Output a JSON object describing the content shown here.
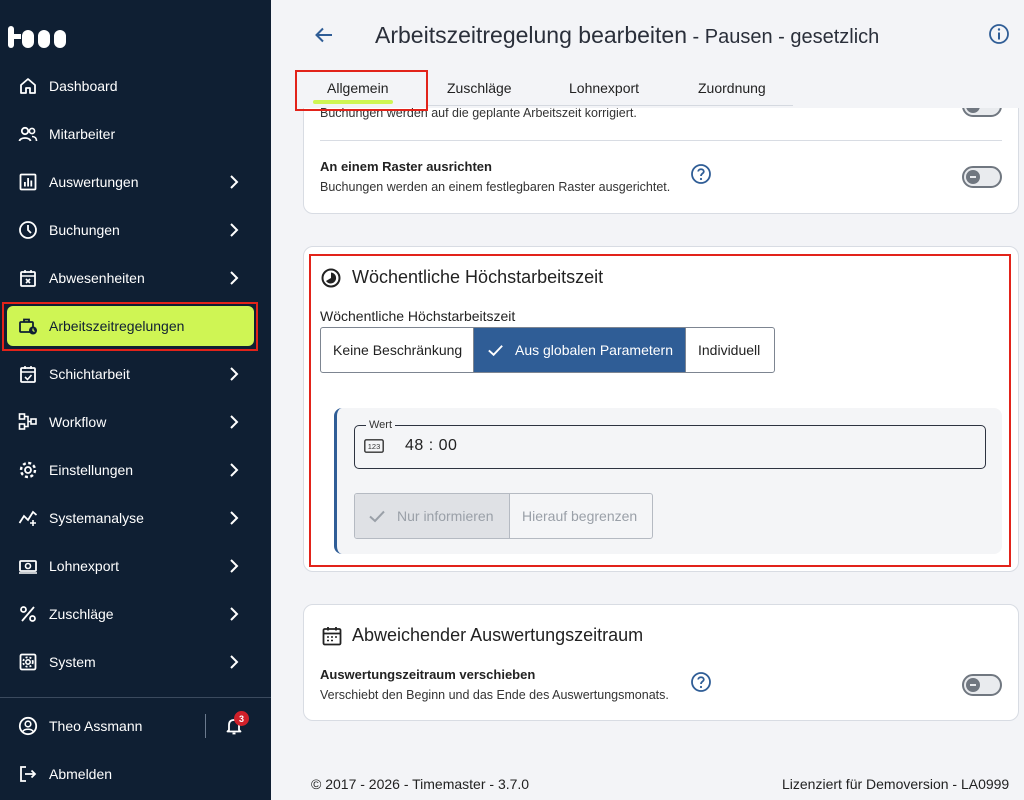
{
  "sidebar": {
    "items": [
      {
        "label": "Dashboard"
      },
      {
        "label": "Mitarbeiter"
      },
      {
        "label": "Auswertungen"
      },
      {
        "label": "Buchungen"
      },
      {
        "label": "Abwesenheiten"
      },
      {
        "label": "Arbeitszeitregelungen"
      },
      {
        "label": "Schichtarbeit"
      },
      {
        "label": "Workflow"
      },
      {
        "label": "Einstellungen"
      },
      {
        "label": "Systemanalyse"
      },
      {
        "label": "Lohnexport"
      },
      {
        "label": "Zuschläge"
      },
      {
        "label": "System"
      }
    ],
    "user_name": "Theo Assmann",
    "notification_count": "3",
    "logout_label": "Abmelden",
    "active_color": "#cff554",
    "bg_color": "#0f1f33"
  },
  "header": {
    "title": "Arbeitszeitregelung bearbeiten",
    "subtitle": " - Pausen - gesetzlich",
    "tabs": [
      {
        "label": "Allgemein"
      },
      {
        "label": "Zuschläge"
      },
      {
        "label": "Lohnexport"
      },
      {
        "label": "Zuordnung"
      }
    ],
    "active_tab": "Allgemein"
  },
  "card1": {
    "partial_desc": "Buchungen werden auf die geplante Arbeitszeit korrigiert.",
    "raster_title": "An einem Raster ausrichten",
    "raster_desc": "Buchungen werden an einem festlegbaren Raster ausgerichtet.",
    "raster_toggle": "off"
  },
  "weekly": {
    "section_title": "Wöchentliche Höchstarbeitszeit",
    "field_label": "Wöchentliche Höchstarbeitszeit",
    "options": [
      "Keine Beschränkung",
      "Aus globalen Parametern",
      "Individuell"
    ],
    "selected_option": "Aus globalen Parametern",
    "value_label": "Wert",
    "value": "48 : 00",
    "mode_options": [
      "Nur informieren",
      "Hierauf begrenzen"
    ],
    "selected_mode": "Nur informieren",
    "accent_color": "#2f5d96"
  },
  "deviating": {
    "section_title": "Abweichender Auswertungszeitraum",
    "row_title": "Auswertungszeitraum verschieben",
    "row_desc": "Verschiebt den Beginn und das Ende des Auswertungsmonats.",
    "toggle": "off"
  },
  "footer": {
    "copyright": "© 2017 - 2026 - Timemaster - 3.7.0",
    "license": "Lizenziert für Demoversion - LA0999"
  }
}
